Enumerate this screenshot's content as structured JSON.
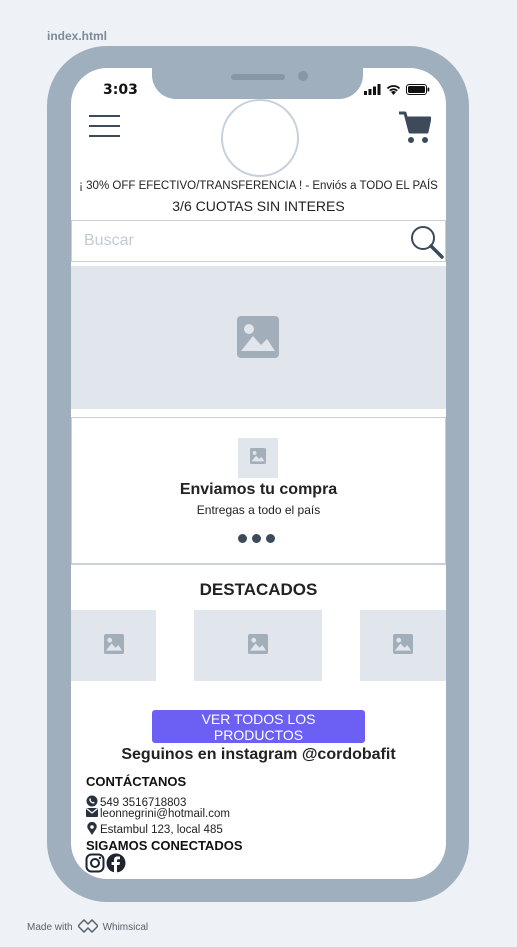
{
  "file_label": "index.html",
  "status_bar": {
    "time": "3:03"
  },
  "promo": {
    "line1": "¡ 30% OFF EFECTIVO/TRANSFERENCIA ! - Enviós a TODO EL PAÍS",
    "line2": "3/6 CUOTAS SIN INTERES"
  },
  "search": {
    "placeholder": "Buscar",
    "value": ""
  },
  "shipping": {
    "title": "Enviamos tu compra",
    "subtitle": "Entregas a todo el país",
    "carousel_dots": 3
  },
  "featured": {
    "title": "DESTACADOS",
    "product_count": 3
  },
  "cta": {
    "label": "VER TODOS LOS PRODUCTOS"
  },
  "instagram": {
    "text": "Seguinos en instagram @cordobafit"
  },
  "contact": {
    "heading": "CONTÁCTANOS",
    "phone": "549 3516718803",
    "email": "leonnegrini@hotmail.com",
    "address": "Estambul 123, local 485"
  },
  "social": {
    "heading": "SIGAMOS CONECTADOS",
    "icons": [
      "instagram-icon",
      "facebook-icon"
    ]
  },
  "footer": {
    "made_with": "Made with",
    "brand": "Whimsical"
  },
  "colors": {
    "accent": "#6c5ff4",
    "frame": "#9fafbd",
    "placeholder_bg": "#e1e5ec",
    "icon": "#3c4a5a"
  }
}
